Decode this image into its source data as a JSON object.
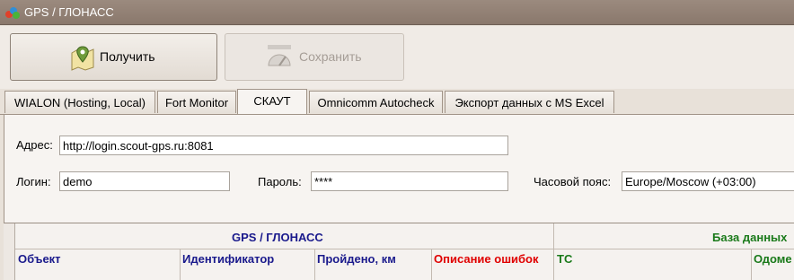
{
  "window": {
    "title": "GPS / ГЛОНАСС"
  },
  "toolbar": {
    "get_label": "Получить",
    "save_label": "Сохранить"
  },
  "tabs": [
    {
      "label": "WIALON (Hosting, Local)"
    },
    {
      "label": "Fort Monitor"
    },
    {
      "label": "СКАУТ"
    },
    {
      "label": "Omnicomm Autocheck"
    },
    {
      "label": "Экспорт данных с MS Excel"
    }
  ],
  "form": {
    "address_label": "Адрес:",
    "address_value": "http://login.scout-gps.ru:8081",
    "login_label": "Логин:",
    "login_value": "demo",
    "password_label": "Пароль:",
    "password_value": "****",
    "timezone_label": "Часовой пояс:",
    "timezone_value": "Europe/Moscow (+03:00)"
  },
  "grid": {
    "group_gps": "GPS / ГЛОНАСС",
    "group_db": "База данных",
    "columns": [
      {
        "label": "Объект",
        "color": "#1a1a8c"
      },
      {
        "label": "Идентификатор",
        "color": "#1a1a8c"
      },
      {
        "label": "Пройдено, км",
        "color": "#1a1a8c"
      },
      {
        "label": "Описание ошибок",
        "color": "#e00000"
      },
      {
        "label": "ТС",
        "color": "#1a7a1a"
      },
      {
        "label": "Одоме",
        "color": "#1a7a1a"
      }
    ]
  }
}
